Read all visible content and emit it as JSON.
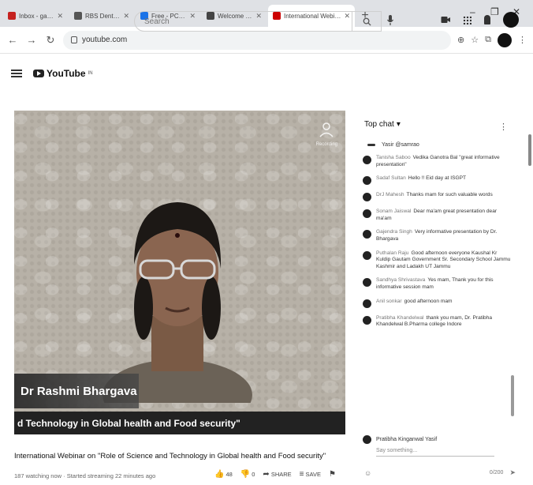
{
  "browser": {
    "tabs": [
      {
        "label": "Inbox - gajendrasahu@...",
        "fav": "#c5221f"
      },
      {
        "label": "RBS Dental University - Lec...",
        "fav": "#555555"
      },
      {
        "label": "Free - PCSA",
        "fav": "#1a73e8"
      },
      {
        "label": "Welcome to rich bharat",
        "fav": "#444444"
      },
      {
        "label": "International Webinar on...",
        "fav": "#cc0000",
        "active": true
      }
    ],
    "address": "youtube.com",
    "win_controls": [
      "–",
      "❐",
      "✕"
    ]
  },
  "youtube": {
    "logo_text": "YouTube",
    "logo_region": "IN",
    "search_placeholder": "Search"
  },
  "video": {
    "speaker_name": "Dr Rashmi Bhargava",
    "caption": "d Technology in Global health and Food security\"",
    "watermark": "Recording"
  },
  "info": {
    "title": "International Webinar on \"Role of Science and Technology in Global health and Food security\"",
    "meta": "187 watching now · Started streaming 22 minutes ago",
    "like": "48",
    "dislike": "0",
    "share": "SHARE",
    "save": "SAVE"
  },
  "chat": {
    "header": "Top chat",
    "pinned_text": "Yasir   @samrao",
    "messages": [
      {
        "author": "Tanisha Saboo",
        "text": "Vedika Ganotra Bal \"great informative presentation\""
      },
      {
        "author": "Sadaf Sultan",
        "text": "Hello !! Eid day at ISGPT"
      },
      {
        "author": "DrJ Mahesh",
        "text": "Thanks mam for such valuable words"
      },
      {
        "author": "Sonam Jaiswal",
        "text": "Dear ma'am great presentation dear ma'am"
      },
      {
        "author": "Gajendra Singh",
        "text": "Very informative presentation by Dr. Bhargava"
      },
      {
        "author": "Puthalan Raju",
        "text": "Good afternoon everyone Kaushal Kr Kuldip Gautam Government Sr. Secondary School Jammu Kashmir and Ladakh UT Jammu"
      },
      {
        "author": "Sandhya Shrivastava",
        "text": "Yes mam, Thank you for this informative session mam"
      },
      {
        "author": "Anil sonkar",
        "text": "good afternoon mam"
      },
      {
        "author": "Pratibha Khandelwal",
        "text": "thank you mam, Dr. Pratibha Khandelwal B.Pharma college Indore"
      }
    ],
    "input_user": "Pratibha Kinganwal Yasif",
    "input_placeholder": "Say something...",
    "counter": "0/200"
  }
}
